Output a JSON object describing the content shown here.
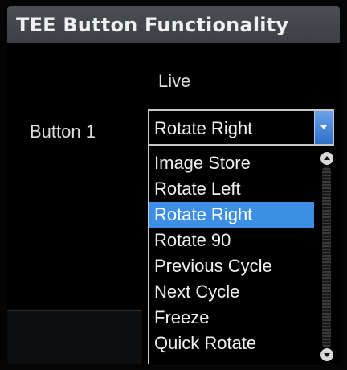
{
  "title": "TEE Button Functionality",
  "column_header": "Live",
  "row_label": "Button 1",
  "select": {
    "value": "Rotate Right"
  },
  "dropdown": {
    "options": [
      "Image Store",
      "Rotate Left",
      "Rotate Right",
      "Rotate 90",
      "Previous Cycle",
      "Next Cycle",
      "Freeze",
      "Quick Rotate"
    ],
    "selected": "Rotate Right"
  },
  "colors": {
    "accent": "#3d8fe6",
    "title_bar": "#45494d"
  }
}
